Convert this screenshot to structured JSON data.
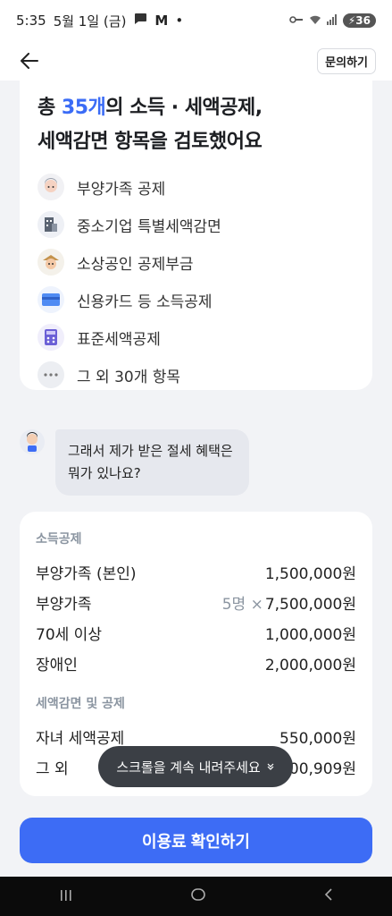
{
  "status_bar": {
    "time": "5:35",
    "date": "5월 1일 (금)",
    "battery": "36"
  },
  "header": {
    "inquiry_label": "문의하기"
  },
  "summary": {
    "title_prefix": "총 ",
    "title_count": "35개",
    "title_suffix": "의 소득 · 세액공제,",
    "title_line2": "세액감면 항목을 검토했어요",
    "items": [
      {
        "label": "부양가족 공제",
        "icon": "family-icon"
      },
      {
        "label": "중소기업 특별세액감면",
        "icon": "building-icon"
      },
      {
        "label": "소상공인 공제부금",
        "icon": "merchant-icon"
      },
      {
        "label": "신용카드 등 소득공제",
        "icon": "credit-card-icon"
      },
      {
        "label": "표준세액공제",
        "icon": "calculator-icon"
      },
      {
        "label": "그 외 30개 항목",
        "icon": "more-icon"
      }
    ]
  },
  "chat": {
    "question": "그래서 제가 받은 절세 혜택은 뭐가 있나요?"
  },
  "calc": {
    "income_title": "소득공제",
    "income_rows": [
      {
        "label": "부양가족 (본인)",
        "mult": "",
        "value": "1,500,000원"
      },
      {
        "label": "부양가족",
        "mult": "5명 ×",
        "value": "7,500,000원"
      },
      {
        "label": "70세 이상",
        "mult": "",
        "value": "1,000,000원"
      },
      {
        "label": "장애인",
        "mult": "",
        "value": "2,000,000원"
      }
    ],
    "tax_title": "세액감면 및 공제",
    "tax_rows": [
      {
        "label": "자녀 세액공제",
        "value": "550,000원"
      },
      {
        "label": "그 외",
        "value": "00,909원"
      }
    ]
  },
  "toast": {
    "label": "스크롤을 계속 내려주세요"
  },
  "cta": {
    "label": "이용료 확인하기"
  }
}
